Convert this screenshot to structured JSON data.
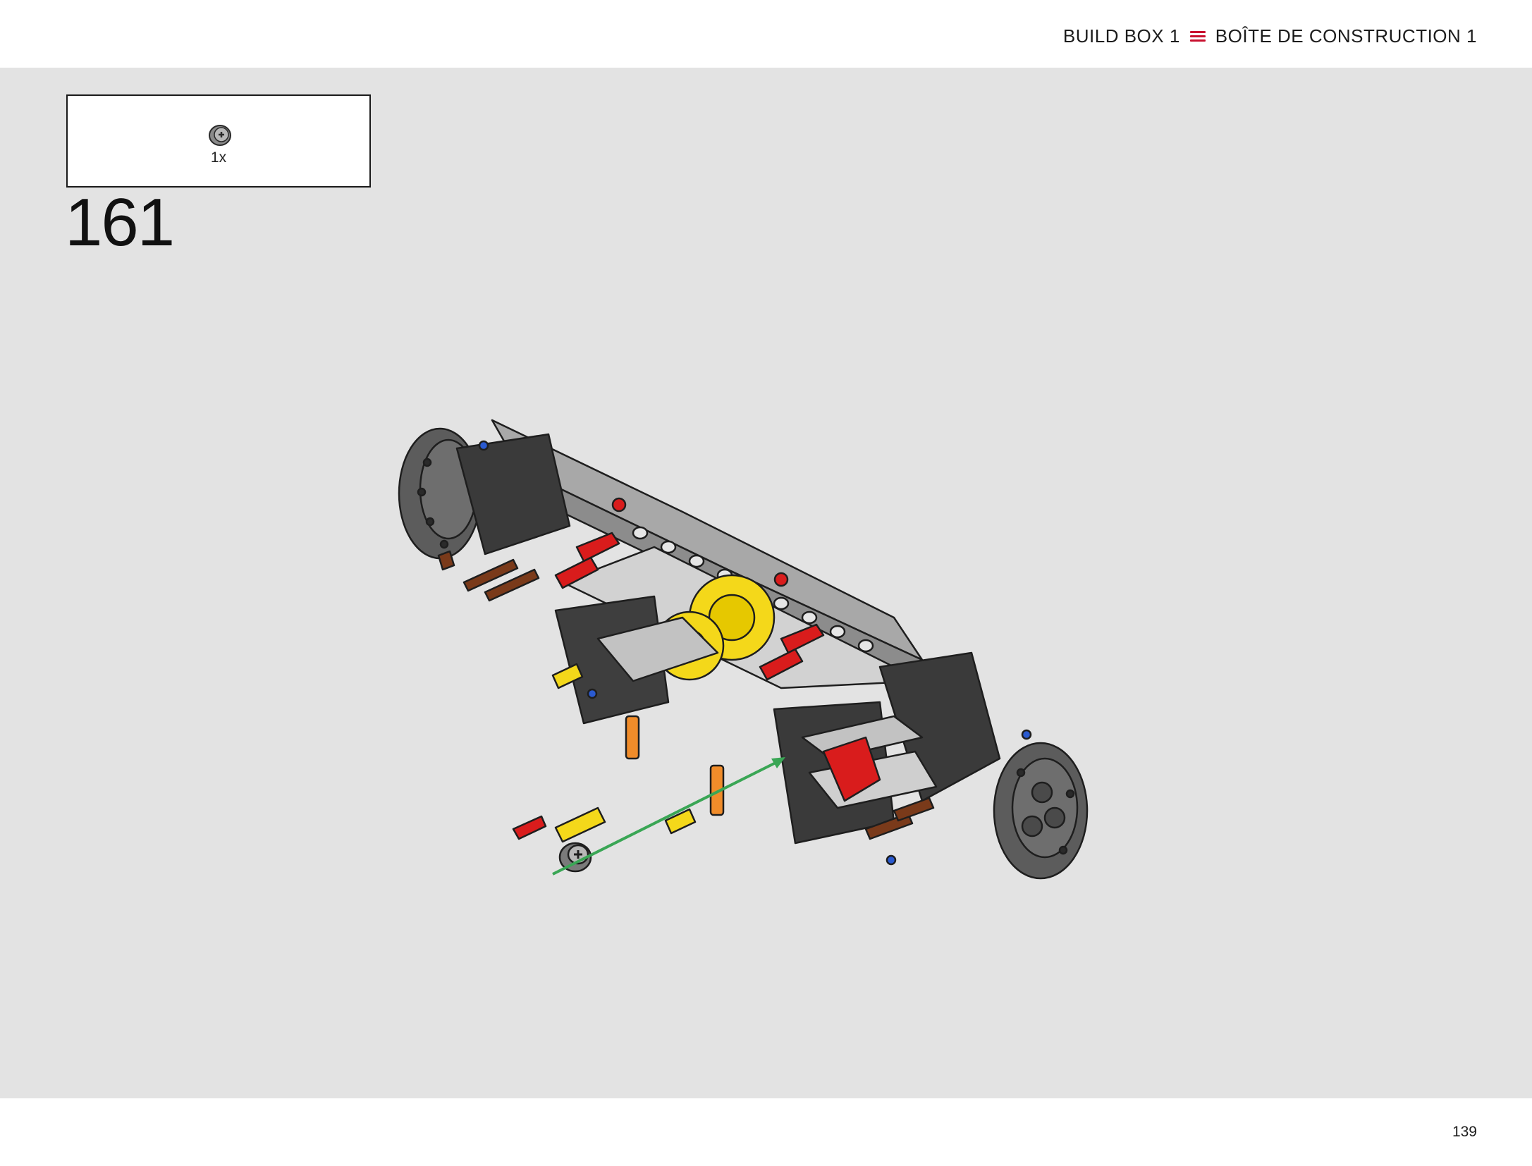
{
  "header": {
    "label_en": "BUILD BOX 1",
    "label_fr": "BOÎTE DE CONSTRUCTION 1",
    "accent_color": "#c8102e",
    "icon": "menu-lines-icon"
  },
  "parts": [
    {
      "icon": "bush-connector-icon",
      "quantity": "1x",
      "color": "#8a8a8a"
    }
  ],
  "step": {
    "number": "161"
  },
  "illustration": {
    "icon": "lego-technic-axle-assembly",
    "insertion_arrow_color": "#3aa655"
  },
  "footer": {
    "page_number": "139"
  }
}
